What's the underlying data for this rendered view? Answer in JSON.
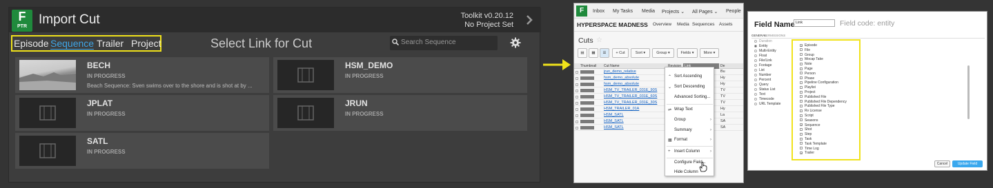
{
  "panel1": {
    "logo_letter": "F",
    "logo_sub": "PTR",
    "title": "Import Cut",
    "toolkit_version": "Toolkit v0.20.12",
    "project_status": "No Project Set",
    "tabs": [
      "Episode",
      "Sequence",
      "Trailer",
      "Project"
    ],
    "active_tab": "Sequence",
    "select_title": "Select Link for Cut",
    "search_placeholder": "Search Sequence",
    "cards": [
      {
        "name": "BECH",
        "status": "IN PROGRESS",
        "desc": "Beach Sequence: Sven swims over to the shore and is shot at by ..."
      },
      {
        "name": "HSM_DEMO",
        "status": "IN PROGRESS",
        "desc": ""
      },
      {
        "name": "JPLAT",
        "status": "IN PROGRESS",
        "desc": ""
      },
      {
        "name": "JRUN",
        "status": "IN PROGRESS",
        "desc": ""
      },
      {
        "name": "SATL",
        "status": "IN PROGRESS",
        "desc": ""
      }
    ],
    "colors": {
      "accent": "#3fa6e8",
      "highlight": "#f0e21a",
      "logo": "#1f8a3c"
    }
  },
  "panel2": {
    "logo_letter": "F",
    "nav": [
      "Inbox",
      "My Tasks",
      "Media",
      "Projects ⌄",
      "All Pages ⌄",
      "People"
    ],
    "project_name": "HYPERSPACE MADNESS",
    "subnav": [
      "Overview",
      "Media",
      "Sequences",
      "Assets"
    ],
    "page_title": "Cuts",
    "toolbar": [
      "+ Cut",
      "Sort ▾",
      "Group ▾",
      "Fields ▾",
      "More ▾"
    ],
    "headers": [
      "Thumbnail",
      "Cut Name",
      "Revision",
      "Link",
      "De"
    ],
    "rows": [
      {
        "name": "jrun_demo_relative",
        "rev": "1",
        "desc": "Bu"
      },
      {
        "name": "hsm_demo_absolute",
        "rev": "2",
        "desc": "Hy"
      },
      {
        "name": "hsm_demo_absolute",
        "rev": "1",
        "desc": "Hy"
      },
      {
        "name": "HSM_TV_TRAILER_031E_90S",
        "rev": "1",
        "desc": "TV"
      },
      {
        "name": "HSM_TV_TRAILER_031E_60S",
        "rev": "1",
        "desc": "TV"
      },
      {
        "name": "HSM_TV_TRAILER_031E_30S",
        "rev": "1",
        "desc": "TV"
      },
      {
        "name": "HSM_TRAILER_01A",
        "rev": "1",
        "desc": "Hy"
      },
      {
        "name": "HSM_SATL",
        "rev": "3",
        "desc": "La"
      },
      {
        "name": "HSM_SATL",
        "rev": "2",
        "desc": "SA"
      },
      {
        "name": "HSM_SATL",
        "rev": "1",
        "desc": "SA"
      }
    ],
    "context_menu": [
      "Sort Ascending",
      "Sort Descending",
      "Advanced Sorting...",
      "Wrap Text",
      "Group",
      "Summary",
      "Format",
      "Insert Column",
      "Configure Field...",
      "Hide Column"
    ]
  },
  "panel3": {
    "field_name_label": "Field Name",
    "field_name_value": "Link",
    "field_code": "Field code: entity",
    "tabs": [
      "GENERAL",
      "PERMISSIONS"
    ],
    "types": [
      "Duration",
      "Entity",
      "Multi-Entity",
      "Float",
      "File/Link",
      "Footage",
      "List",
      "Number",
      "Percent",
      "Query",
      "Status List",
      "Text",
      "Timecode",
      "URL Template"
    ],
    "entities": [
      {
        "label": "Episode",
        "checked": true
      },
      {
        "label": "File",
        "checked": false
      },
      {
        "label": "Group",
        "checked": false
      },
      {
        "label": "Mocap Take",
        "checked": false
      },
      {
        "label": "Note",
        "checked": false
      },
      {
        "label": "Page",
        "checked": false
      },
      {
        "label": "Person",
        "checked": false
      },
      {
        "label": "Phase",
        "checked": false
      },
      {
        "label": "Pipeline Configuration",
        "checked": false
      },
      {
        "label": "Playlist",
        "checked": false
      },
      {
        "label": "Project",
        "checked": false
      },
      {
        "label": "Published File",
        "checked": false
      },
      {
        "label": "Published File Dependency",
        "checked": false
      },
      {
        "label": "Published File Type",
        "checked": false
      },
      {
        "label": "Rv License",
        "checked": false
      },
      {
        "label": "Script",
        "checked": false
      },
      {
        "label": "Seasons",
        "checked": false
      },
      {
        "label": "Sequence",
        "checked": true
      },
      {
        "label": "Shot",
        "checked": false
      },
      {
        "label": "Step",
        "checked": false
      },
      {
        "label": "Task",
        "checked": false
      },
      {
        "label": "Task Template",
        "checked": false
      },
      {
        "label": "Time Log",
        "checked": false
      },
      {
        "label": "Trailer",
        "checked": true
      }
    ],
    "cancel": "Cancel",
    "update": "Update Field"
  }
}
